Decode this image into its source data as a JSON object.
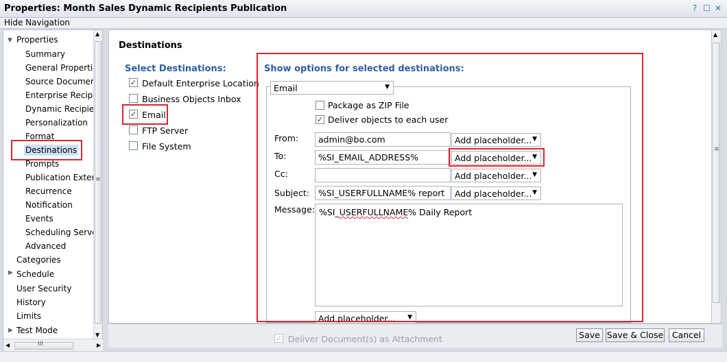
{
  "window": {
    "title": "Properties: Month Sales Dynamic Recipients Publication",
    "controls": {
      "help": "?",
      "maximize": "☐",
      "close": "✕"
    }
  },
  "hide_navigation": "Hide Navigation",
  "nav": {
    "properties": "Properties",
    "items": [
      "Summary",
      "General Properties",
      "Source Documents",
      "Enterprise Recipients",
      "Dynamic Recipients",
      "Personalization",
      "Format",
      "Destinations",
      "Prompts",
      "Publication Extensions",
      "Recurrence",
      "Notification",
      "Events",
      "Scheduling Server",
      "Advanced"
    ],
    "top_items": [
      "Categories",
      "Schedule",
      "User Security",
      "History",
      "Limits",
      "Test Mode"
    ],
    "hscroll_grip": "III",
    "vscroll_grip": "≡"
  },
  "destinations": {
    "heading": "Destinations",
    "select_heading": "Select Destinations:",
    "options": [
      {
        "label": "Default Enterprise Location",
        "checked": true
      },
      {
        "label": "Business Objects Inbox",
        "checked": false
      },
      {
        "label": "Email",
        "checked": true
      },
      {
        "label": "FTP Server",
        "checked": false
      },
      {
        "label": "File System",
        "checked": false
      }
    ]
  },
  "options_panel": {
    "heading": "Show options for selected destinations:",
    "dest_dropdown": "Email",
    "package_zip": {
      "label": "Package as ZIP File",
      "checked": false
    },
    "deliver_each": {
      "label": "Deliver objects to each user",
      "checked": true
    },
    "fields": {
      "from": {
        "label": "From:",
        "value": "admin@bo.com",
        "placeholder_btn": "Add placeholder..."
      },
      "to": {
        "label": "To:",
        "value": "%SI_EMAIL_ADDRESS%",
        "placeholder_btn": "Add placeholder..."
      },
      "cc": {
        "label": "Cc:",
        "value": "",
        "placeholder_btn": "Add placeholder..."
      },
      "subject": {
        "label": "Subject:",
        "value": "%SI_USERFULLNAME% report",
        "placeholder_btn": "Add placeholder..."
      },
      "message": {
        "label": "Message:",
        "value_part1": "%SI_",
        "value_squiggle": "USERFULLNAME",
        "value_part2": "% Daily Report",
        "placeholder_btn": "Add placeholder..."
      }
    },
    "attachment": "Deliver Document(s) as Attachment"
  },
  "footer": {
    "save": "Save",
    "save_close": "Save & Close",
    "cancel": "Cancel"
  },
  "colors": {
    "highlight": "#d9262e",
    "heading_blue": "#2f5fa3",
    "selected_bg": "#cde0f7"
  }
}
